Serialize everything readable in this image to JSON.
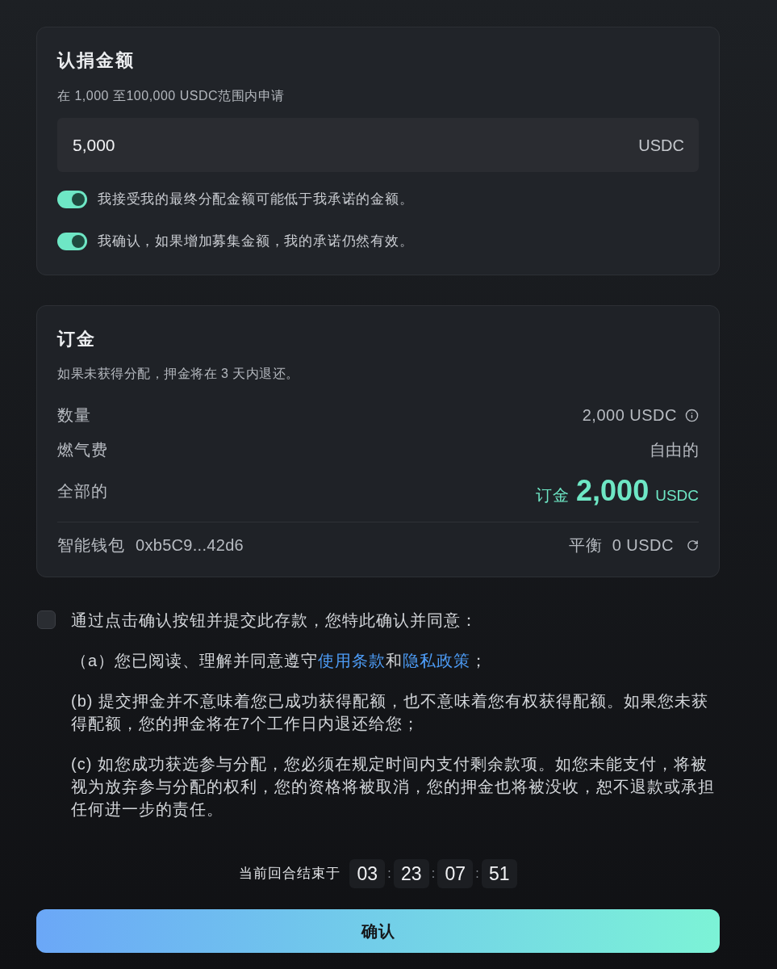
{
  "subscription": {
    "title": "认捐金额",
    "hint": "在 1,000 至100,000 USDC范围内申请",
    "amount": {
      "value": "5,000",
      "unit": "USDC"
    },
    "toggles": [
      {
        "label": "我接受我的最终分配金额可能低于我承诺的金额。",
        "on": true
      },
      {
        "label": "我确认，如果增加募集金额，我的承诺仍然有效。",
        "on": true
      }
    ]
  },
  "deposit": {
    "title": "订金",
    "hint": "如果未获得分配，押金将在 3 天内退还。",
    "rows": [
      {
        "kind": "info",
        "label": "数量",
        "value": "2,000 USDC"
      },
      {
        "kind": "plain",
        "label": "燃气费",
        "value": "自由的"
      },
      {
        "kind": "total",
        "label": "全部的",
        "prefix": "订金",
        "amount": "2,000",
        "unit": "USDC"
      }
    ],
    "wallet": {
      "label": "智能钱包",
      "address": "0xb5C9...42d6",
      "balance_label": "平衡",
      "balance": "0 USDC"
    }
  },
  "agreement": {
    "checked": false,
    "intro": "通过点击确认按钮并提交此存款，您特此确认并同意：",
    "clauses": [
      {
        "parts": [
          {
            "text": "（a）您已阅读、理解并同意遵守",
            "link": false
          },
          {
            "text": "使用条款",
            "link": true
          },
          {
            "text": "和",
            "link": false
          },
          {
            "text": "隐私政策",
            "link": true
          },
          {
            "text": "；",
            "link": false
          }
        ]
      },
      {
        "parts": [
          {
            "text": "(b) 提交押金并不意味着您已成功获得配额，也不意味着您有权获得配额。如果您未获得配额，您的押金将在7个工作日内退还给您；",
            "link": false
          }
        ]
      },
      {
        "parts": [
          {
            "text": "(c) 如您成功获选参与分配，您必须在规定时间内支付剩余款项。如您未能支付，将被视为放弃参与分配的权利，您的资格将被取消，您的押金也将被没收，恕不退款或承担任何进一步的责任。",
            "link": false
          }
        ]
      }
    ]
  },
  "countdown": {
    "label": "当前回合结束于",
    "segments": [
      {
        "kind": "digits",
        "text": "03"
      },
      {
        "kind": "separator",
        "text": ":"
      },
      {
        "kind": "digits",
        "text": "23"
      },
      {
        "kind": "separator",
        "text": ":"
      },
      {
        "kind": "digits",
        "text": "07"
      },
      {
        "kind": "separator",
        "text": ":"
      },
      {
        "kind": "digits",
        "text": "51"
      }
    ]
  },
  "confirm_button": {
    "label": "确认"
  }
}
